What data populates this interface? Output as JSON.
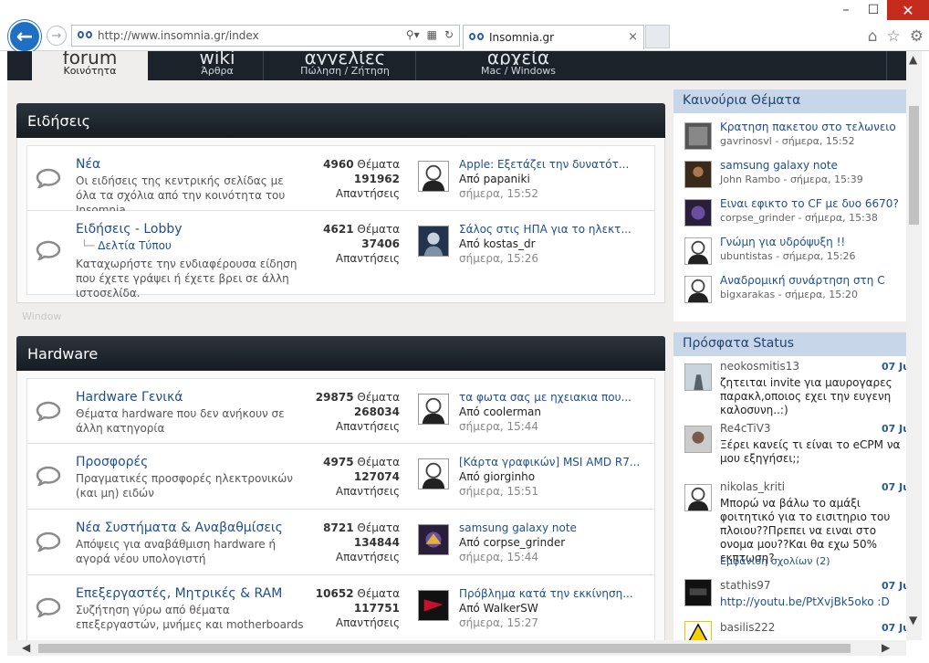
{
  "window": {
    "min": "–",
    "max": "☐",
    "close": "✕"
  },
  "browser": {
    "url_host": "http://www.insomnia.gr",
    "url_path": "/index",
    "tab_title": "Insomnia.gr",
    "tab_close": "×"
  },
  "topnav": [
    {
      "big": "forum",
      "small": "Κοινότητα"
    },
    {
      "big": "wiki",
      "small": "Άρθρα"
    },
    {
      "big": "αγγελίες",
      "small": "Πώληση / Ζήτηση"
    },
    {
      "big": "αρχεία",
      "small": "Mac / Windows"
    }
  ],
  "sections": [
    {
      "title": "Ειδήσεις",
      "forums": [
        {
          "title": "Νέα",
          "sub": "",
          "desc": "Οι ειδήσεις της κεντρικής σελίδας με όλα τα σχόλια από την κοινότητα του Insomnia",
          "topics": "4960",
          "topics_label": "Θέματα",
          "replies": "191962",
          "replies_label": "Απαντήσεις",
          "last_title": "Apple: Εξετάζει την δυνατότ...",
          "by": "Από",
          "last_user": "papaniki",
          "last_time": "σήμερα, 15:52"
        },
        {
          "title": "Ειδήσεις - Lobby",
          "sub": "Δελτία Τύπου",
          "desc": "Καταχωρήστε την ενδιαφέρουσα είδηση που έχετε γράψει ή έχετε βρει σε άλλη ιστοσελίδα.",
          "topics": "4621",
          "topics_label": "Θέματα",
          "replies": "37406",
          "replies_label": "Απαντήσεις",
          "last_title": "Σάλος στις ΗΠΑ για το ηλεκτ...",
          "by": "Από",
          "last_user": "kostas_dr",
          "last_time": "σήμερα, 15:26"
        }
      ]
    },
    {
      "title": "Hardware",
      "forums": [
        {
          "title": "Hardware Γενικά",
          "sub": "",
          "desc": "Θέματα hardware που δεν ανήκουν σε άλλη κατηγορία",
          "topics": "29875",
          "topics_label": "Θέματα",
          "replies": "268034",
          "replies_label": "Απαντήσεις",
          "last_title": "τα φωτα σας με ηχειακια που...",
          "by": "Από",
          "last_user": "coolerman",
          "last_time": "σήμερα, 15:44"
        },
        {
          "title": "Προσφορές",
          "sub": "",
          "desc": "Πραγματικές προσφορές ηλεκτρονικών (και μη) ειδών",
          "topics": "4975",
          "topics_label": "Θέματα",
          "replies": "127074",
          "replies_label": "Απαντήσεις",
          "last_title": "[Κάρτα γραφικών] MSI AMD R7...",
          "by": "Από",
          "last_user": "giorginho",
          "last_time": "σήμερα, 15:51"
        },
        {
          "title": "Νέα Συστήματα & Αναβαθμίσεις",
          "sub": "",
          "desc": "Απόψεις για αναβάθμιση hardware ή αγορά νέου υπολογιστή",
          "topics": "8721",
          "topics_label": "Θέματα",
          "replies": "134844",
          "replies_label": "Απαντήσεις",
          "last_title": "samsung galaxy note",
          "by": "Από",
          "last_user": "corpse_grinder",
          "last_time": "σήμερα, 15:44"
        },
        {
          "title": "Επεξεργαστές, Μητρικές & RAM",
          "sub": "",
          "desc": "Συζήτηση γύρω από θέματα επεξεργαστών, μνήμες και motherboards",
          "topics": "10652",
          "topics_label": "Θέματα",
          "replies": "117751",
          "replies_label": "Απαντήσεις",
          "last_title": "Πρόβλημα κατά την εκκίνηση...",
          "by": "Από",
          "last_user": "WalkerSW",
          "last_time": "σήμερα, 15:27"
        }
      ]
    }
  ],
  "side_threads": {
    "title": "Καινούρια Θέματα",
    "items": [
      {
        "title": "Κρατηση πακετου στο τελωνειο",
        "meta": "gavrinosvl - σήμερα, 15:52"
      },
      {
        "title": "samsung galaxy note",
        "meta": "John Rambo - σήμερα, 15:39"
      },
      {
        "title": "Ειναι εφικτο το CF με δυο 6670?",
        "meta": "corpse_grinder - σήμερα, 15:38"
      },
      {
        "title": "Γνώμη για υδρόψυξη !!",
        "meta": "ubuntistas - σήμερα, 15:26"
      },
      {
        "title": "Αναδρομική συνάρτηση στη C",
        "meta": "bigxarakas - σήμερα, 15:20"
      }
    ]
  },
  "side_status": {
    "title": "Πρόσφατα Status",
    "items": [
      {
        "user": "neokosmitis13",
        "date": "07 Ju",
        "text": "ζητειται invite για μαυρογαρες παρακλ,οποιος εχει την ευγενη καλοσυνη..:)",
        "link": ""
      },
      {
        "user": "Re4cTiV3",
        "date": "07 Ju",
        "text": "Ξέρει κανείς τι είναι το eCPM να μου εξηγήσει;;",
        "link": ""
      },
      {
        "user": "nikolas_kriti",
        "date": "07 Ju",
        "text": "Μπορώ να βάλω το αμάξι φοιτητικό για το εισιτηριο του πλοιου??Πρεπει να ειναι στο ονομα μου??Και θα εχω 50% εκπτωση?",
        "link": "Εμφάνιση σχολίων (2)"
      },
      {
        "user": "stathis97",
        "date": "07 Ju",
        "text": "http://youtu.be/PtXvjBk5oko :D",
        "link": ""
      },
      {
        "user": "basilis222",
        "date": "07 Ju",
        "text": "",
        "link": ""
      }
    ]
  },
  "ghost_text": "Window"
}
